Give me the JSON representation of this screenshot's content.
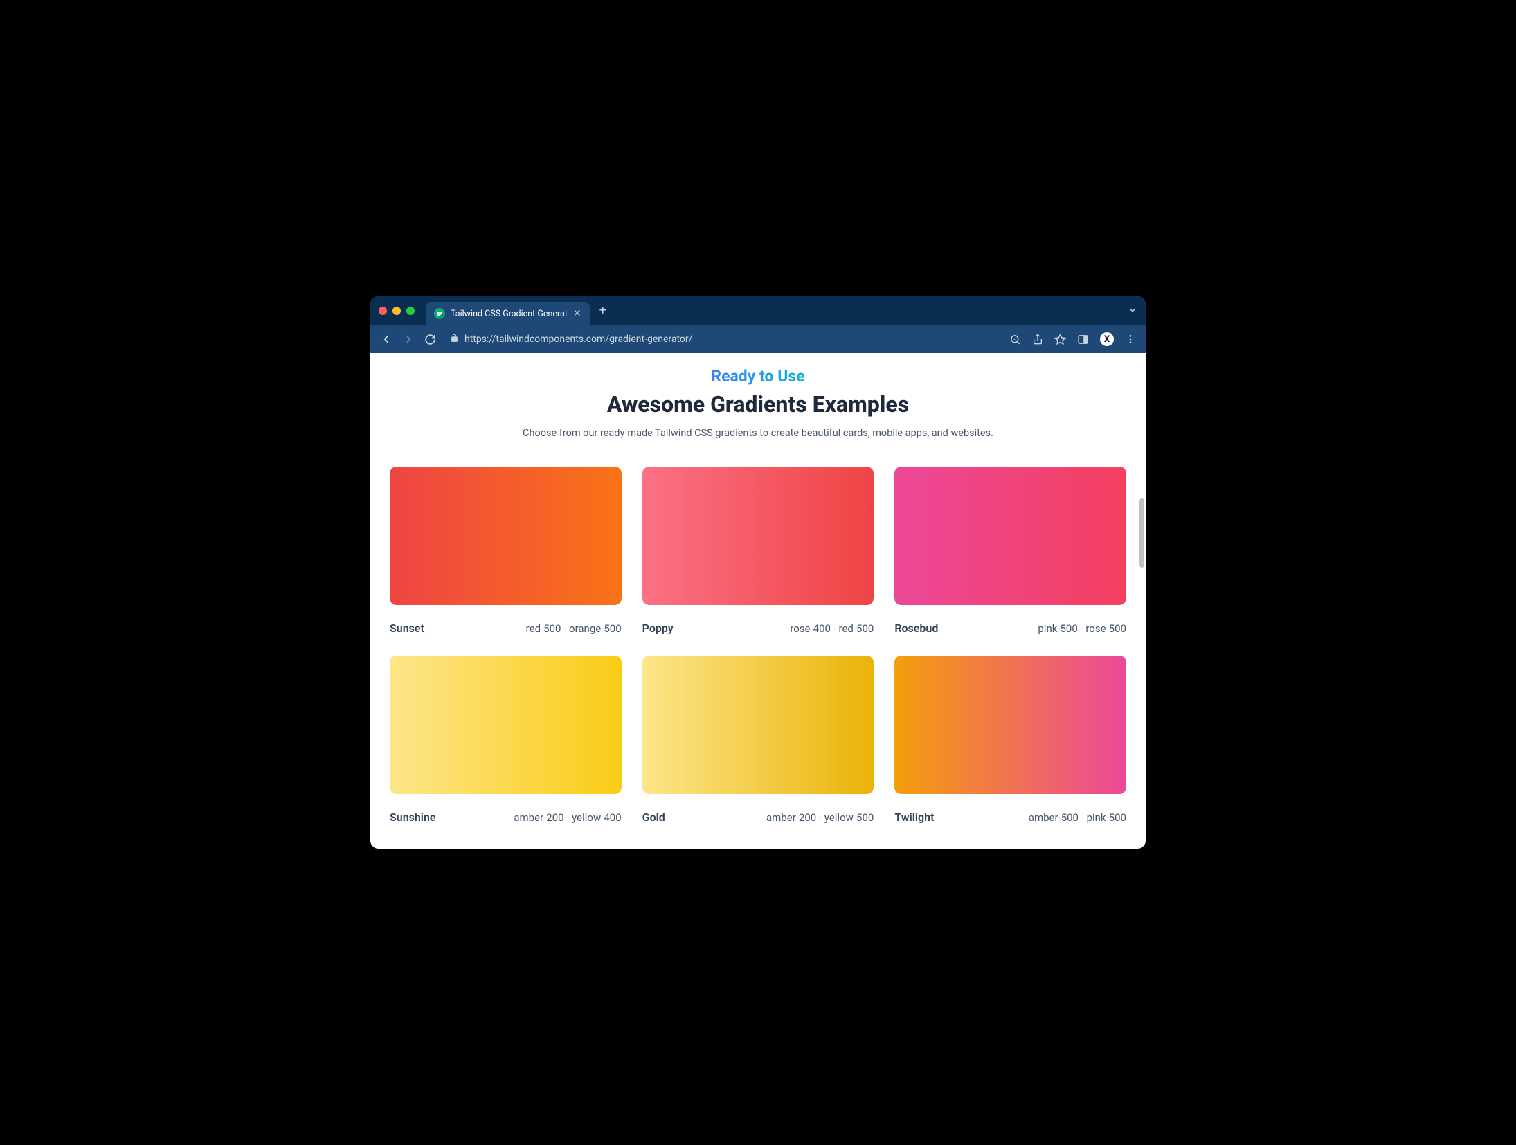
{
  "browser": {
    "tab_title": "Tailwind CSS Gradient Generat",
    "url_display": "https://tailwindcomponents.com/gradient-generator/",
    "avatar_letter": "X"
  },
  "header": {
    "eyebrow": "Ready to Use",
    "title": "Awesome Gradients Examples",
    "subtitle": "Choose from our ready-made Tailwind CSS gradients to create beautiful cards, mobile apps, and websites."
  },
  "gradients": [
    {
      "name": "Sunset",
      "colors_label": "red-500 - orange-500",
      "from": "#ef4444",
      "to": "#f97316"
    },
    {
      "name": "Poppy",
      "colors_label": "rose-400 - red-500",
      "from": "#fb7185",
      "to": "#ef4444"
    },
    {
      "name": "Rosebud",
      "colors_label": "pink-500 - rose-500",
      "from": "#ec4899",
      "to": "#f43f5e"
    },
    {
      "name": "Sunshine",
      "colors_label": "amber-200 - yellow-400",
      "from": "#fde68a",
      "to": "#facc15"
    },
    {
      "name": "Gold",
      "colors_label": "amber-200 - yellow-500",
      "from": "#fde68a",
      "to": "#eab308"
    },
    {
      "name": "Twilight",
      "colors_label": "amber-500 - pink-500",
      "from": "#f59e0b",
      "to": "#ec4899"
    }
  ]
}
